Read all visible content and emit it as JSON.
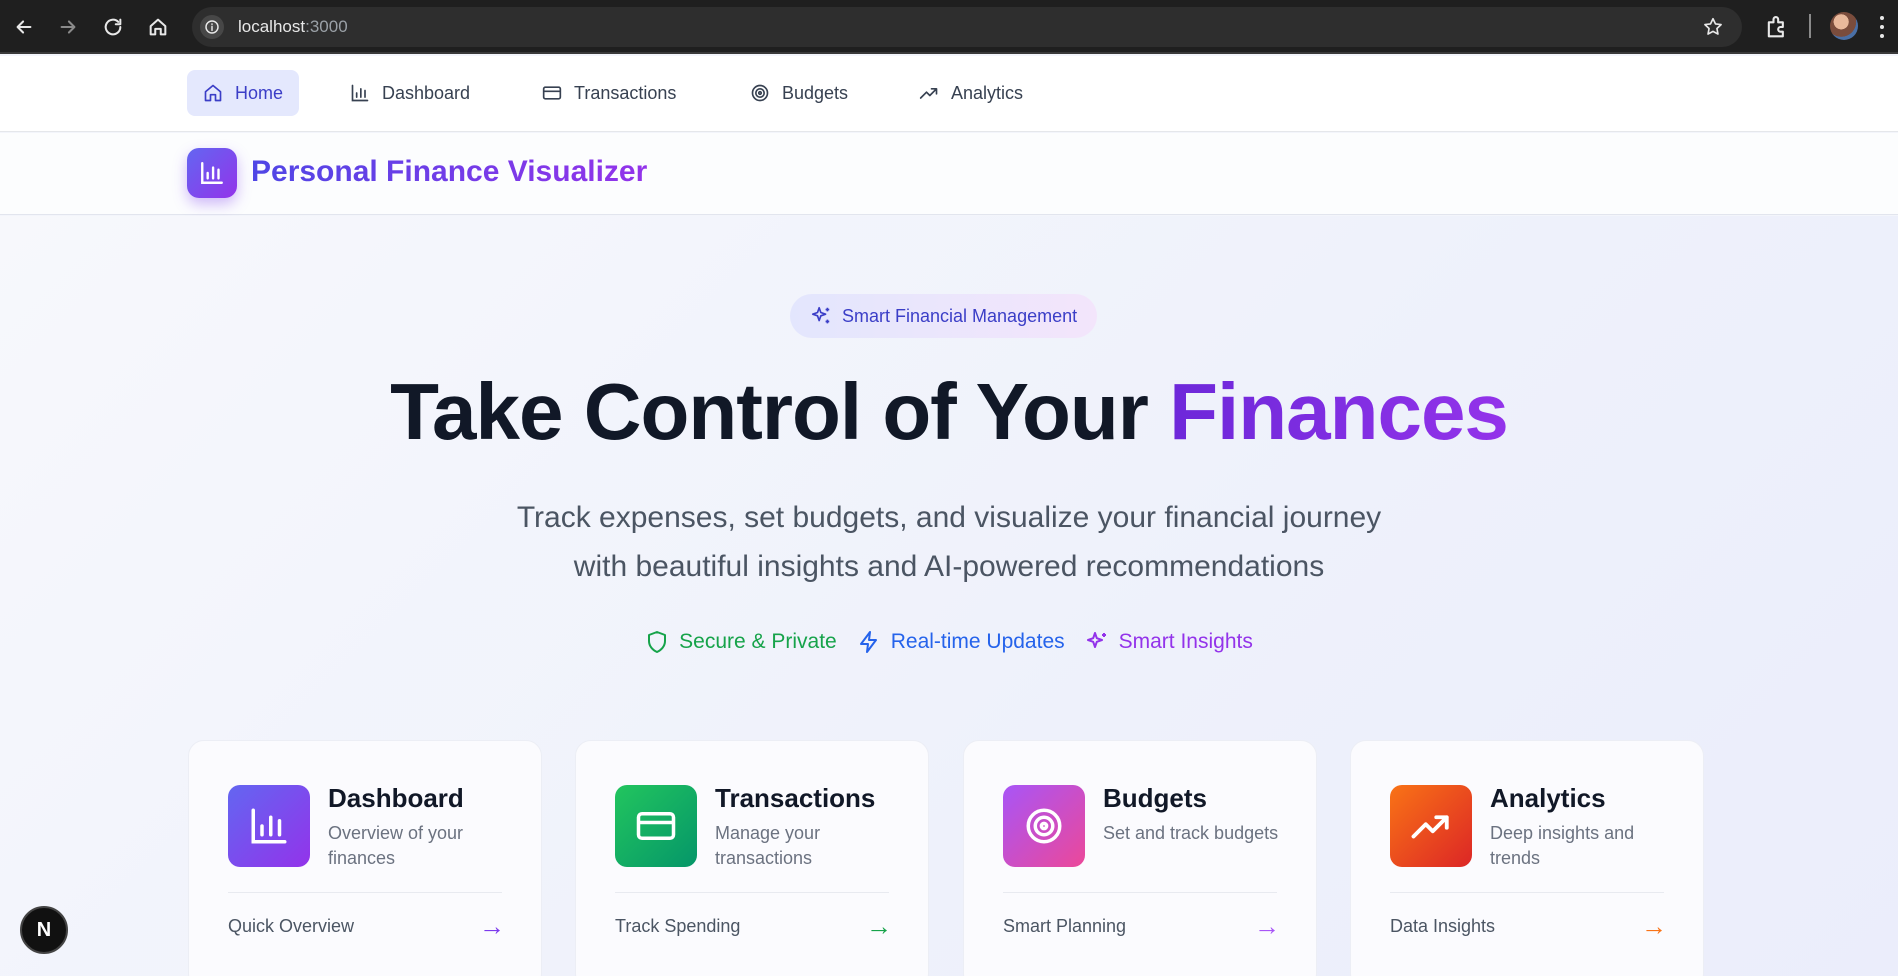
{
  "browser": {
    "url_host": "localhost",
    "url_port": ":3000"
  },
  "nav": {
    "items": [
      {
        "label": "Home",
        "icon": "home-icon",
        "active": true
      },
      {
        "label": "Dashboard",
        "icon": "bar-chart-icon",
        "active": false
      },
      {
        "label": "Transactions",
        "icon": "credit-card-icon",
        "active": false
      },
      {
        "label": "Budgets",
        "icon": "target-icon",
        "active": false
      },
      {
        "label": "Analytics",
        "icon": "trending-up-icon",
        "active": false
      }
    ]
  },
  "brand": {
    "title": "Personal Finance Visualizer",
    "icon": "bar-chart-icon"
  },
  "hero": {
    "pill": "Smart Financial Management",
    "headline_main": "Take Control of Your ",
    "headline_accent": "Finances",
    "subtitle_line1": "Track expenses, set budgets, and visualize your financial journey",
    "subtitle_line2": "with beautiful insights and AI-powered recommendations",
    "features": [
      {
        "label": "Secure & Private",
        "icon": "shield-icon",
        "color": "#16a34a"
      },
      {
        "label": "Real-time Updates",
        "icon": "zap-icon",
        "color": "#2563eb"
      },
      {
        "label": "Smart Insights",
        "icon": "sparkles-icon",
        "color": "#9333ea"
      }
    ]
  },
  "cards": [
    {
      "title": "Dashboard",
      "desc": "Overview of your finances",
      "footer": "Quick Overview",
      "arrow": "→",
      "icon": "bar-chart-icon",
      "accent": "#7c3aed"
    },
    {
      "title": "Transactions",
      "desc": "Manage your transactions",
      "footer": "Track Spending",
      "arrow": "→",
      "icon": "credit-card-icon",
      "accent": "#16a34a"
    },
    {
      "title": "Budgets",
      "desc": "Set and track budgets",
      "footer": "Smart Planning",
      "arrow": "→",
      "icon": "target-icon",
      "accent": "#a855f7"
    },
    {
      "title": "Analytics",
      "desc": "Deep insights and trends",
      "footer": "Data Insights",
      "arrow": "→",
      "icon": "trending-up-icon",
      "accent": "#f97316"
    }
  ],
  "devtools": {
    "label": "N"
  }
}
